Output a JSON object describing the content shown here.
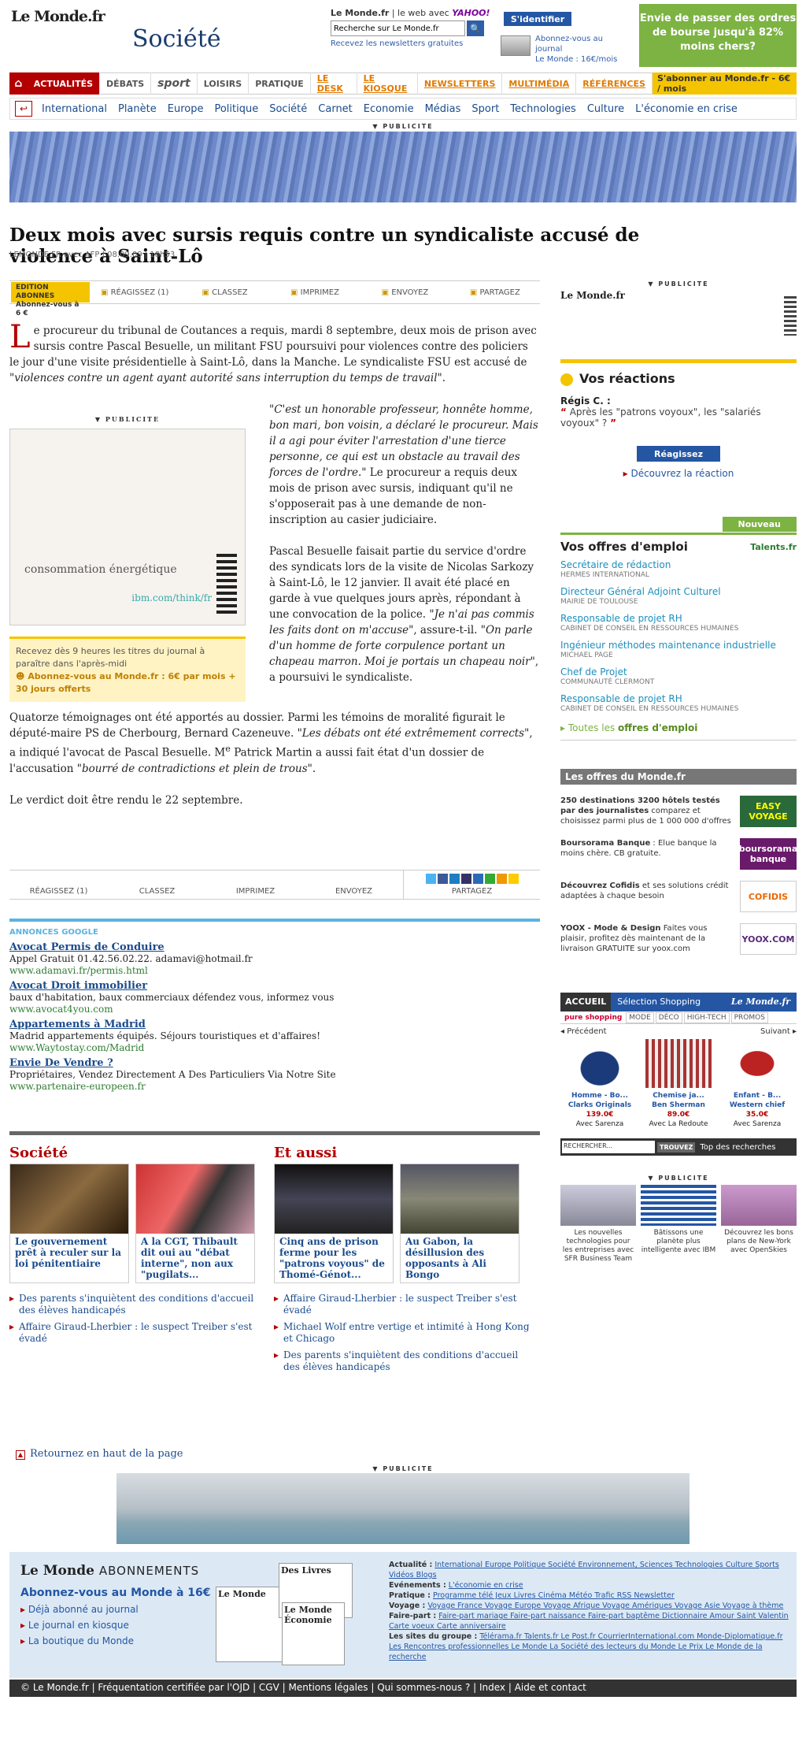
{
  "header": {
    "logo": "Le Monde.fr",
    "section": "Société",
    "search_top_left": "Le Monde.fr",
    "search_top_mid": " | le web avec ",
    "search_yahoo": "YAHOO!",
    "search_placeholder": "Recherche sur Le Monde.fr",
    "search_btn": "🔍",
    "newsletter": "Recevez les newsletters gratuites",
    "identify": "S'identifier",
    "abo_line1": "Abonnez-vous au journal",
    "abo_line2": "Le Monde : 16€/mois",
    "promo": "Envie de passer des ordres de bourse jusqu'à 82% moins chers?"
  },
  "nav1": {
    "home": "⌂",
    "items": [
      "ACTUALITÉS",
      "DÉBATS",
      "sport",
      "LOISIRS",
      "PRATIQUE",
      "LE DESK",
      "LE KIOSQUE",
      "NEWSLETTERS",
      "MULTIMÉDIA",
      "RÉFÉRENCES"
    ],
    "subscribe": "S'abonner au Monde.fr - 6€ / mois"
  },
  "nav2": {
    "icon": "↩",
    "items": [
      "International",
      "Planète",
      "Europe",
      "Politique",
      "Société",
      "Carnet",
      "Economie",
      "Médias",
      "Sport",
      "Technologies",
      "Culture",
      "L'économie en crise"
    ]
  },
  "pub_label": "▼ PUBLICITE",
  "article": {
    "title": "Deux mois avec sursis requis contre un syndicaliste accusé de violence à Saint-Lô",
    "byline": "LEMONDE.FR avec AFP | 08.09.09 | 18h53",
    "dropcap": "L",
    "p1": "e procureur du tribunal de Coutances a requis, mardi 8 septembre, deux mois de prison avec sursis contre Pascal Besuelle, un militant FSU poursuivi pour violences contre des policiers le jour d'une visite présidentielle à Saint-Lô, dans la Manche. Le syndicaliste FSU est accusé de ",
    "p1_quote": "\"violences contre un agent ayant autorité sans interruption du temps de travail\"",
    "p1_end": ".",
    "p2_quote": "\"C'est un honorable professeur, honnête homme, bon mari, bon voisin, a déclaré le procureur. Mais il a agi pour éviter l'arrestation d'une tierce personne, ce qui est un obstacle au travail des forces de l'ordre.\"",
    "p2_rest": " Le procureur a requis deux mois de prison avec sursis, indiquant qu'il ne s'opposerait pas à une demande de non-inscription au casier judiciaire.",
    "p3_a": "Pascal Besuelle faisait partie du service d'ordre des syndicats lors de la visite de Nicolas Sarkozy à Saint-Lô, le 12 janvier. Il avait été placé en garde à vue quelques jours après, répondant à une convocation de la police. ",
    "p3_q1": "\"Je n'ai pas commis les faits dont on m'accuse\"",
    "p3_b": ", assure-t-il. ",
    "p3_q2": "\"On parle d'un homme de forte corpulence portant un chapeau marron. Moi je portais un chapeau noir\"",
    "p3_c": ", a poursuivi le syndicaliste.",
    "p4_a": "Quatorze témoignages ont été apportés au dossier. Parmi les témoins de moralité figurait le député-maire PS de Cherbourg, Bernard Cazeneuve. ",
    "p4_q1": "\"Les débats ont été extrêmement corrects\"",
    "p4_b": ", a indiqué l'avocat de Pascal Besuelle. M",
    "p4_sup": "e",
    "p4_c": " Patrick Martin a aussi fait état d'un dossier de l'accusation ",
    "p4_q2": "\"bourré de contradictions et plein de trous\"",
    "p4_d": ".",
    "p5": "Le verdict doit être rendu le 22 septembre."
  },
  "toolbar": {
    "edition": "EDITION ABONNES Abonnez-vous à 6 €",
    "reagir": "RÉAGISSEZ (1)",
    "classez": "CLASSEZ",
    "imprimez": "IMPRIMEZ",
    "envoyez": "ENVOYEZ",
    "partagez": "PARTAGEZ"
  },
  "inline_pub": {
    "text": "consommation énergétique",
    "url": "ibm.com/think/fr"
  },
  "abo_box": {
    "text": "Recevez dès 9 heures les titres du journal à paraître dans l'après-midi",
    "link": "Abonnez-vous au Monde.fr : 6€ par mois + 30 jours offerts"
  },
  "google_ads": {
    "heading": "ANNONCES GOOGLE",
    "items": [
      {
        "title": "Avocat Permis de Conduire",
        "desc": "Appel Gratuit 01.42.56.02.22. adamavi@hotmail.fr",
        "url": "www.adamavi.fr/permis.html"
      },
      {
        "title": "Avocat Droit immobilier",
        "desc": "baux d'habitation, baux commerciaux défendez vous, informez vous",
        "url": "www.avocat4you.com"
      },
      {
        "title": "Appartements à Madrid",
        "desc": "Madrid appartements équipés. Séjours touristiques et d'affaires!",
        "url": "www.Waytostay.com/Madrid"
      },
      {
        "title": "Envie De Vendre ?",
        "desc": "Propriétaires, Vendez Directement A Des Particuliers Via Notre Site",
        "url": "www.partenaire-europeen.fr"
      }
    ]
  },
  "bottom": {
    "societe_h": "Société",
    "aussi_h": "Et aussi",
    "cards": [
      "Le gouvernement prêt à reculer sur la loi pénitentiaire",
      "A la CGT, Thibault dit oui au \"débat interne\", non aux \"pugilats...",
      "Cinq ans de prison ferme pour les \"patrons voyous\" de Thomé-Génot...",
      "Au Gabon, la désillusion des opposants à Ali Bongo"
    ],
    "list_left": [
      "Des parents s'inquiètent des conditions d'accueil des élèves handicapés",
      "Affaire Giraud-Lherbier : le suspect Treiber s'est évadé"
    ],
    "list_right": [
      "Affaire Giraud-Lherbier : le suspect Treiber s'est évadé",
      "Michael Wolf entre vertige et intimité à Hong Kong et Chicago",
      "Des parents s'inquiètent des conditions d'accueil des élèves handicapés"
    ]
  },
  "right": {
    "lm": "Le Monde.fr",
    "ibm": "IBM",
    "reac_h": "Vos réactions",
    "reac_name": "Régis C. :",
    "reac_quote": "Après les \"patrons voyoux\", les \"salariés voyoux\" ?",
    "reag_btn": "Réagissez",
    "decouv": "Découvrez la réaction",
    "nouveau": "Nouveau",
    "jobs_h": "Vos offres d'emploi",
    "talents": "Talents.fr",
    "jobs": [
      {
        "t": "Secrétaire de rédaction",
        "s": "HERMES INTERNATIONAL"
      },
      {
        "t": "Directeur Général Adjoint Culturel",
        "s": "MAIRIE DE TOULOUSE"
      },
      {
        "t": "Responsable de projet RH",
        "s": "CABINET DE CONSEIL EN RESSOURCES HUMAINES"
      },
      {
        "t": "Ingénieur méthodes maintenance industrielle",
        "s": "MICHAEL PAGE"
      },
      {
        "t": "Chef de Projet",
        "s": "COMMUNAUTÉ CLERMONT"
      },
      {
        "t": "Responsable de projet RH",
        "s": "CABINET DE CONSEIL EN RESSOURCES HUMAINES"
      }
    ],
    "jobs_all_a": "Toutes les ",
    "jobs_all_b": "offres d'emploi",
    "offres_h": "Les offres du Monde.fr",
    "offres": [
      {
        "b": "250 destinations 3200 hôtels testés par des journalistes",
        "r": " comparez et choisissez parmi plus de 1 000 000 d'offres",
        "logo": "EASY VOYAGE"
      },
      {
        "b": "Boursorama Banque",
        "r": " : Elue banque la moins chère. CB gratuite.",
        "logo": "boursorama banque"
      },
      {
        "b": "Découvrez Cofidis",
        "r": " et ses solutions crédit adaptées à chaque besoin",
        "logo": "COFIDIS"
      },
      {
        "b": "YOOX - Mode & Design",
        "r": " Faites vous plaisir, profitez dès maintenant de la livraison GRATUITE sur yoox.com",
        "logo": "YOOX.COM"
      }
    ],
    "shop": {
      "accueil": "ACCUEIL",
      "sel": "Sélection Shopping",
      "lm": "Le Monde.fr",
      "pure": "pure shopping",
      "subs": [
        "MODE",
        "DÉCO",
        "HIGH-TECH",
        "PROMOS"
      ],
      "prev": "◂ Précédent",
      "next": "Suivant ▸",
      "prods": [
        {
          "n": "Homme - Bo...",
          "b": "Clarks Originals",
          "p": "139.0€",
          "s": "Avec Sarenza"
        },
        {
          "n": "Chemise ja...",
          "b": "Ben Sherman",
          "p": "89.0€",
          "s": "Avec La Redoute"
        },
        {
          "n": "Enfant - B...",
          "b": "Western chief",
          "p": "35.0€",
          "s": "Avec Sarenza"
        }
      ],
      "search": "RECHERCHER...",
      "btn": "TROUVEZ",
      "top": "Top des recherches"
    },
    "tiles": [
      "Les nouvelles technologies pour les entreprises avec SFR Business Team",
      "Bâtissons une planète plus intelligente avec IBM",
      "Découvrez les bons plans de New-York avec OpenSkies"
    ]
  },
  "backtop": "Retournez en haut de la page",
  "footer": {
    "lm": "Le Monde",
    "abo": "ABONNEMENTS",
    "sub": "Abonnez-vous au Monde à 16€",
    "links": [
      "Déjà abonné au journal",
      "Le journal en kiosque",
      "La boutique du Monde"
    ],
    "paper1": "Le Monde",
    "paper2": "Des Livres",
    "paper3": "Le Monde Économie",
    "rows": [
      {
        "k": "Actualité :",
        "v": "International  Europe  Politique  Société  Environnement, Sciences  Technologies  Culture  Sports  Vidéos  Blogs"
      },
      {
        "k": "Evénements :",
        "v": "L'économie en crise"
      },
      {
        "k": "Pratique :",
        "v": "Programme télé  Jeux  Livres  Cinéma  Météo  Trafic  RSS  Newsletter"
      },
      {
        "k": "Voyage :",
        "v": "Voyage France  Voyage Europe  Voyage Afrique  Voyage Amériques  Voyage Asie  Voyage à thème"
      },
      {
        "k": "Faire-part :",
        "v": "Faire-part mariage  Faire-part naissance  Faire-part baptême  Dictionnaire Amour  Saint Valentin  Carte voeux  Carte anniversaire"
      },
      {
        "k": "Les sites du groupe :",
        "v": "Télérama.fr  Talents.fr  Le Post.fr  CourrierInternational.com  Monde-Diplomatique.fr  Les Rencontres professionnelles Le Monde  La Société des lecteurs du Monde  Le Prix Le Monde de la recherche"
      }
    ]
  },
  "copyright": "© Le Monde.fr | Fréquentation certifiée par l'OJD | CGV | Mentions légales | Qui sommes-nous ? | Index | Aide et contact"
}
